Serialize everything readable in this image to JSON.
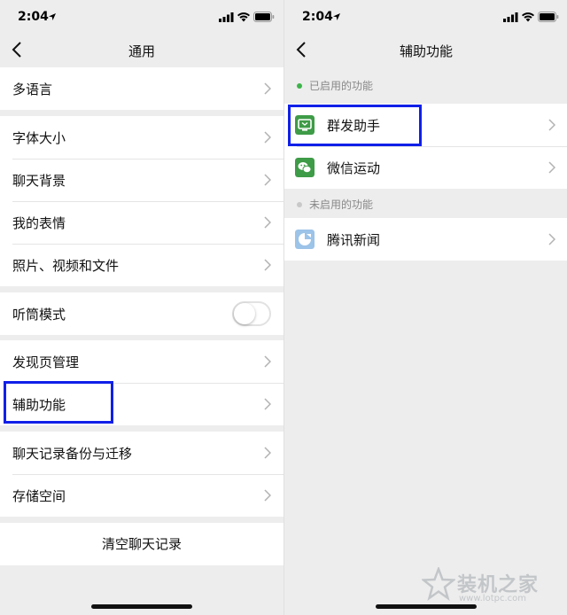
{
  "status_bar": {
    "time": "2:04"
  },
  "left_screen": {
    "title": "通用",
    "groups": [
      {
        "items": [
          "多语言"
        ]
      },
      {
        "items": [
          "字体大小",
          "聊天背景",
          "我的表情",
          "照片、视频和文件"
        ]
      },
      {
        "items": [
          "听筒模式"
        ]
      },
      {
        "items": [
          "发现页管理",
          "辅助功能"
        ]
      },
      {
        "items": [
          "聊天记录备份与迁移",
          "存储空间"
        ]
      }
    ],
    "toggle_on": false,
    "clear_button": "清空聊天记录",
    "highlighted_item": "辅助功能"
  },
  "right_screen": {
    "title": "辅助功能",
    "enabled_header": "已启用的功能",
    "enabled_items": [
      {
        "label": "群发助手",
        "icon": "group-send-icon",
        "color": "#3e9b47"
      },
      {
        "label": "微信运动",
        "icon": "wechat-sport-icon",
        "color": "#3e9b47"
      }
    ],
    "disabled_header": "未启用的功能",
    "disabled_items": [
      {
        "label": "腾讯新闻",
        "icon": "tencent-news-icon",
        "color": "#9cc3e8"
      }
    ],
    "highlighted_item": "群发助手"
  },
  "colors": {
    "highlight": "#1020e8",
    "enabled_dot": "#3cb44a",
    "disabled_dot": "#c8c8c8",
    "background": "#ededed"
  },
  "watermark": {
    "brand": "装机之家",
    "url": "www.lotpc.com"
  }
}
